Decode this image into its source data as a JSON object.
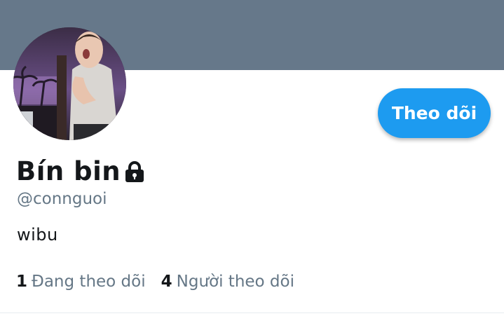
{
  "profile": {
    "display_name": "Bín bin",
    "handle": "@connguoi",
    "bio": "wibu",
    "protected": true,
    "follow_button_label": "Theo dõi"
  },
  "stats": {
    "following_count": "1",
    "following_label": "Đang theo dõi",
    "followers_count": "4",
    "followers_label": "Người theo dõi"
  },
  "icons": {
    "lock": "lock-icon"
  },
  "colors": {
    "banner": "#66788a",
    "accent": "#1d9bf0",
    "primary_text": "#14171a",
    "secondary_text": "#657786"
  }
}
